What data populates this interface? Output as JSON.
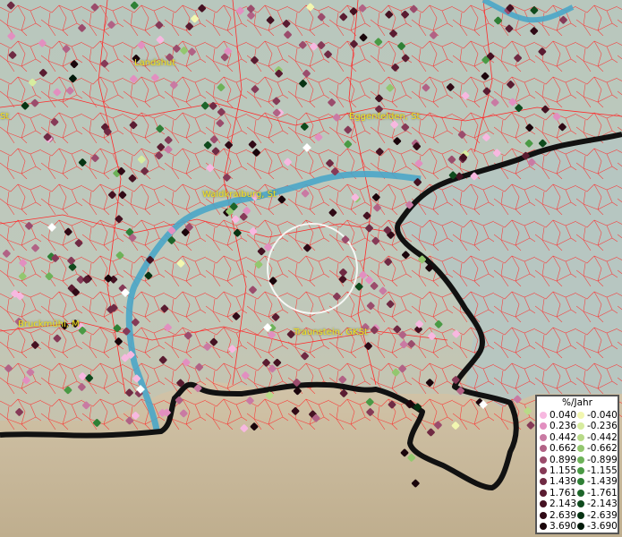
{
  "places": [
    {
      "label": "Landshut"
    },
    {
      "label": "St"
    },
    {
      "label": "Eggenfelden, St"
    },
    {
      "label": "Waldkraiburg, St"
    },
    {
      "label": "Bruckmühl, M"
    },
    {
      "label": "Traunstein, GKSt"
    }
  ],
  "legend": {
    "title": "%/Jahr",
    "positive": [
      {
        "label": "0.040",
        "color": "#f7b8e0"
      },
      {
        "label": "0.236",
        "color": "#e28fc0"
      },
      {
        "label": "0.442",
        "color": "#c97aa3"
      },
      {
        "label": "0.662",
        "color": "#b16285"
      },
      {
        "label": "0.899",
        "color": "#9b4c6c"
      },
      {
        "label": "1.155",
        "color": "#863a57"
      },
      {
        "label": "1.439",
        "color": "#6f2a43"
      },
      {
        "label": "1.761",
        "color": "#5a1c31"
      },
      {
        "label": "2.143",
        "color": "#451222"
      },
      {
        "label": "2.639",
        "color": "#300a16"
      },
      {
        "label": "3.690",
        "color": "#1a050b"
      }
    ],
    "negative": [
      {
        "label": "-0.040",
        "color": "#f2f7b0"
      },
      {
        "label": "-0.236",
        "color": "#d7ec9f"
      },
      {
        "label": "-0.442",
        "color": "#b8da88"
      },
      {
        "label": "-0.662",
        "color": "#93c76f"
      },
      {
        "label": "-0.899",
        "color": "#6db259"
      },
      {
        "label": "-1.155",
        "color": "#4a9a45"
      },
      {
        "label": "-1.439",
        "color": "#2f8036"
      },
      {
        "label": "-1.761",
        "color": "#1d652a"
      },
      {
        "label": "-2.143",
        "color": "#0f4a1d"
      },
      {
        "label": "-2.639",
        "color": "#073313"
      },
      {
        "label": "-3.690",
        "color": "#02190a"
      }
    ]
  },
  "colors": {
    "terrain": "#b9c6bd",
    "river": "#4aa6c8",
    "borders": "#ff2a2a",
    "country_border": "#111111",
    "label": "#f0e020",
    "selection_circle": "#ffffff"
  }
}
